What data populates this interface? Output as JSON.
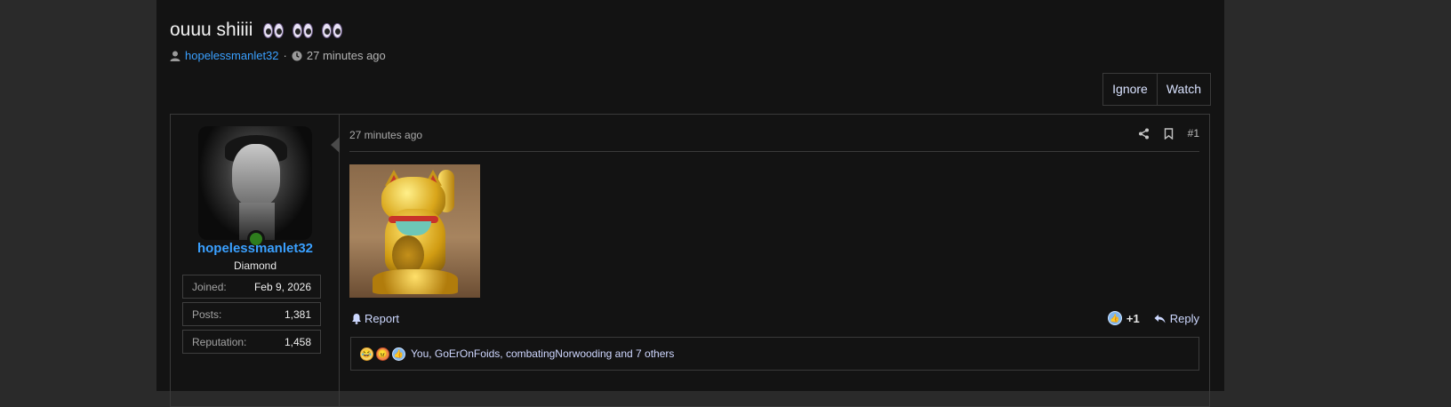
{
  "thread": {
    "title": "ouuu shiiii",
    "title_emoji": [
      "eyes-emoji",
      "eyes-emoji",
      "eyes-emoji"
    ],
    "author": "hopelessmanlet32",
    "meta_separator": "·",
    "time": "27 minutes ago"
  },
  "thread_actions": {
    "ignore": "Ignore",
    "watch": "Watch"
  },
  "post": {
    "user": {
      "name": "hopelessmanlet32",
      "title": "Diamond",
      "online": true,
      "stats": [
        {
          "label": "Joined:",
          "value": "Feb 9, 2026"
        },
        {
          "label": "Posts:",
          "value": "1,381"
        },
        {
          "label": "Reputation:",
          "value": "1,458"
        }
      ]
    },
    "time": "27 minutes ago",
    "number": "#1",
    "actions": {
      "report": "Report",
      "reaction_count": "+1",
      "reply": "Reply"
    },
    "reactions_summary": "You, GoErOnFoids, combatingNorwooding and 7 others",
    "reaction_icons": [
      "laugh",
      "angry",
      "like"
    ]
  },
  "colors": {
    "link": "#3aa0ff",
    "online": "#2e7d1d",
    "background": "#131313",
    "outer": "#2a2a2a"
  }
}
